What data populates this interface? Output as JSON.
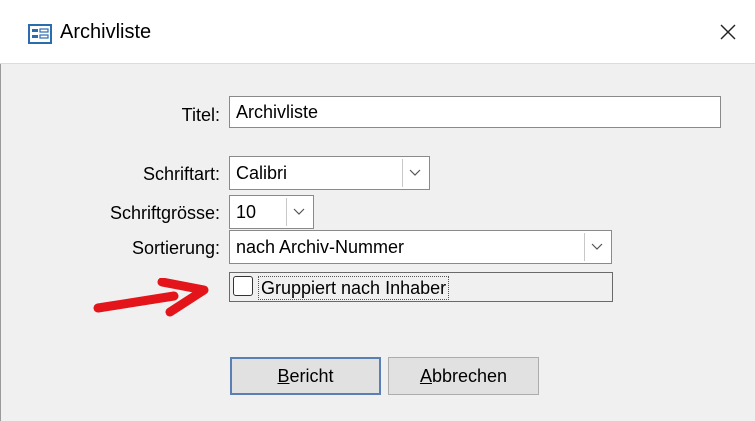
{
  "window": {
    "title": "Archivliste",
    "icon": "form-icon",
    "close_symbol": "✕"
  },
  "form": {
    "titel_label": "Titel:",
    "titel_value": "Archivliste",
    "schriftart_label": "Schriftart:",
    "schriftart_value": "Calibri",
    "schriftgroesse_label": "Schriftgrösse:",
    "schriftgroesse_value": "10",
    "sortierung_label": "Sortierung:",
    "sortierung_value": "nach Archiv-Nummer",
    "gruppiert_label": "Gruppiert nach Inhaber",
    "gruppiert_checked": false
  },
  "buttons": {
    "bericht_first": "B",
    "bericht_rest": "ericht",
    "abbrechen_first": "A",
    "abbrechen_rest": "bbrechen"
  },
  "annotation": {
    "arrow_color": "#e3151a"
  }
}
